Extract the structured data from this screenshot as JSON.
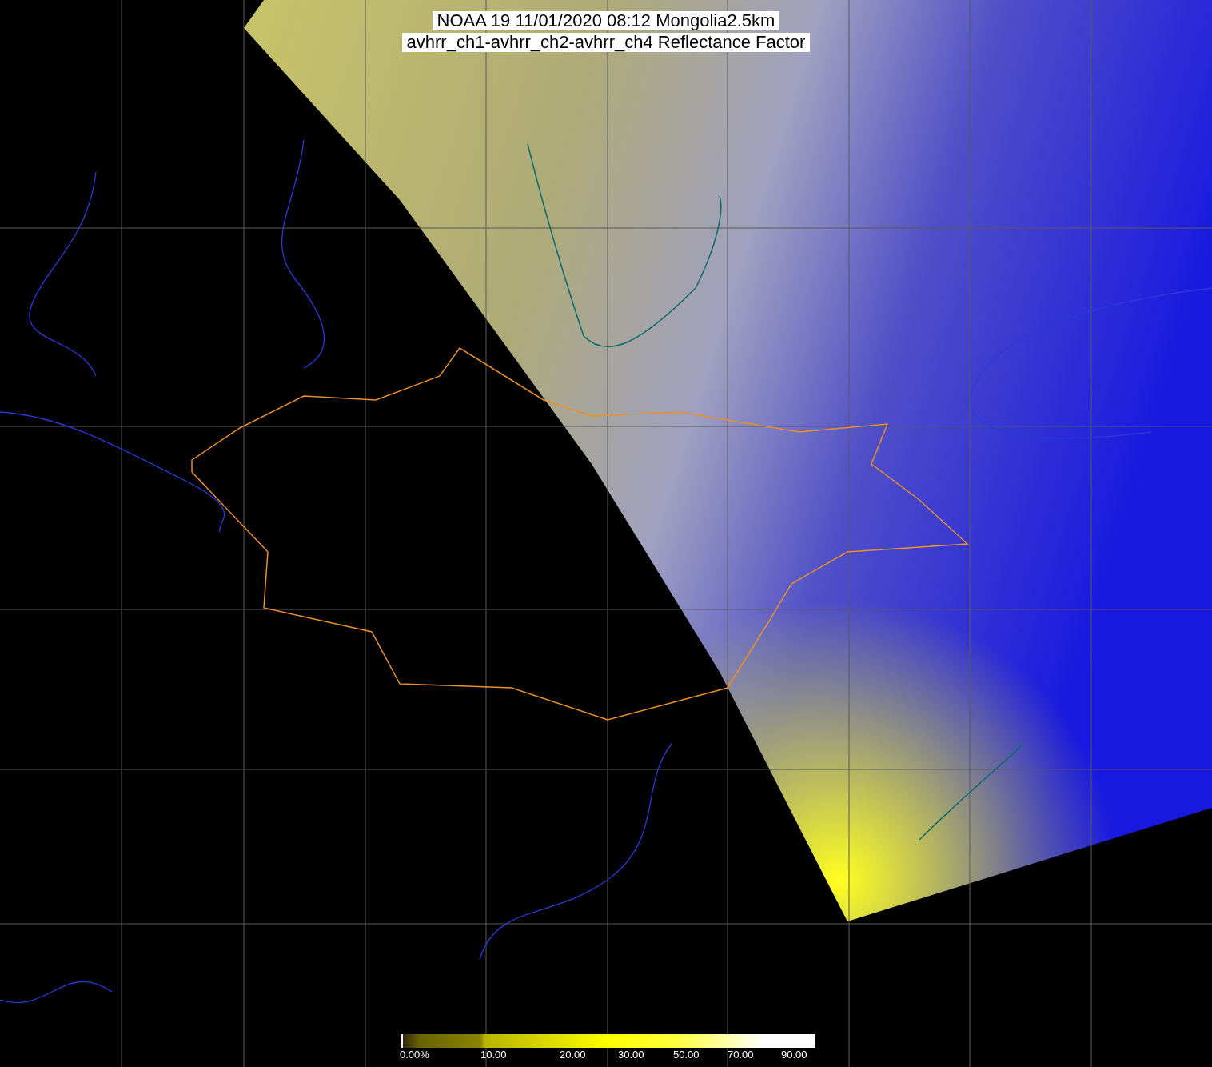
{
  "title_lines": [
    "NOAA 19 11/01/2020 08:12 Mongolia2.5km",
    "avhrr_ch1-avhrr_ch2-avhrr_ch4 Reflectance Factor"
  ],
  "colorbar": {
    "labels": [
      "0.00%",
      "10.00",
      "20.00",
      "30.00",
      "50.00",
      "70.00",
      "90.00"
    ]
  }
}
